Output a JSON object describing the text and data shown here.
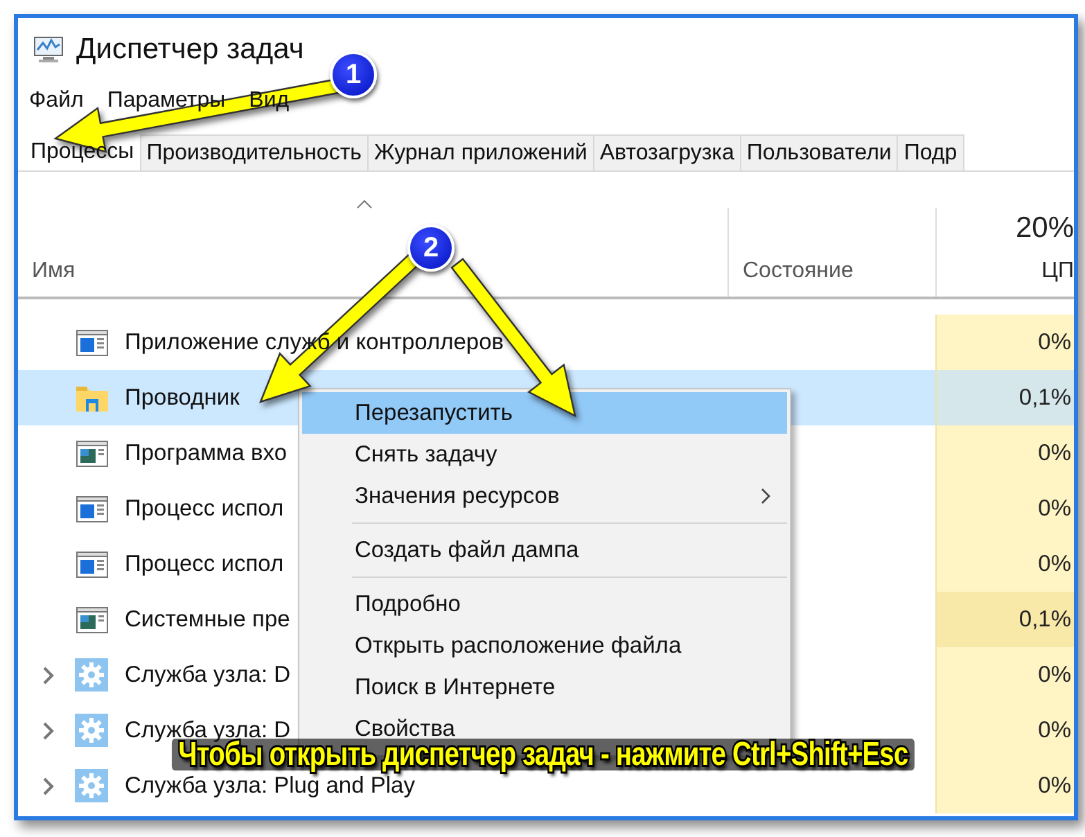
{
  "window": {
    "title": "Диспетчер задач"
  },
  "menu": [
    "Файл",
    "Параметры",
    "Вид"
  ],
  "tabs": [
    {
      "label": "Процессы",
      "selected": true
    },
    {
      "label": "Производительность",
      "selected": false
    },
    {
      "label": "Журнал приложений",
      "selected": false
    },
    {
      "label": "Автозагрузка",
      "selected": false
    },
    {
      "label": "Пользователи",
      "selected": false
    },
    {
      "label": "Подр",
      "selected": false
    }
  ],
  "table": {
    "columns": [
      "Имя",
      "Состояние",
      "ЦП"
    ],
    "cpu_total": "20%",
    "rows": [
      {
        "kind": "window",
        "name": "Приложение служб и контроллеров",
        "cpu": "0%",
        "selected": false,
        "busy": false
      },
      {
        "kind": "folder",
        "name": "Проводник",
        "cpu": "0,1%",
        "selected": true,
        "busy": false
      },
      {
        "kind": "picture-window",
        "name": "Программа вхо",
        "cpu": "0%",
        "selected": false,
        "busy": false
      },
      {
        "kind": "window",
        "name": "Процесс испол",
        "cpu": "0%",
        "selected": false,
        "busy": false
      },
      {
        "kind": "window",
        "name": "Процесс испол",
        "cpu": "0%",
        "selected": false,
        "busy": false
      },
      {
        "kind": "picture-window",
        "name": "Системные пре",
        "cpu": "0,1%",
        "selected": false,
        "busy": true
      },
      {
        "kind": "service",
        "name": "Служба узла: D",
        "cpu": "0%",
        "selected": false,
        "busy": false
      },
      {
        "kind": "service",
        "name": "Служба узла: D",
        "cpu": "0%",
        "selected": false,
        "busy": false
      },
      {
        "kind": "service",
        "name": "Служба узла: Plug and Play",
        "cpu": "0%",
        "selected": false,
        "busy": false
      }
    ]
  },
  "context_menu": [
    {
      "kind": "item",
      "label": "Перезапустить",
      "selected": true
    },
    {
      "kind": "item",
      "label": "Снять задачу",
      "selected": false
    },
    {
      "kind": "submenu",
      "label": "Значения ресурсов",
      "selected": false
    },
    {
      "kind": "separator"
    },
    {
      "kind": "item",
      "label": "Создать файл дампа",
      "selected": false
    },
    {
      "kind": "separator"
    },
    {
      "kind": "item",
      "label": "Подробно",
      "selected": false
    },
    {
      "kind": "item",
      "label": "Открыть расположение файла",
      "selected": false
    },
    {
      "kind": "item",
      "label": "Поиск в Интернете",
      "selected": false
    },
    {
      "kind": "item",
      "label": "Свойства",
      "selected": false
    }
  ],
  "annotations": {
    "badges": [
      "1",
      "2"
    ],
    "caption": "Чтобы открыть диспетчер задач - нажмите Ctrl+Shift+Esc"
  }
}
